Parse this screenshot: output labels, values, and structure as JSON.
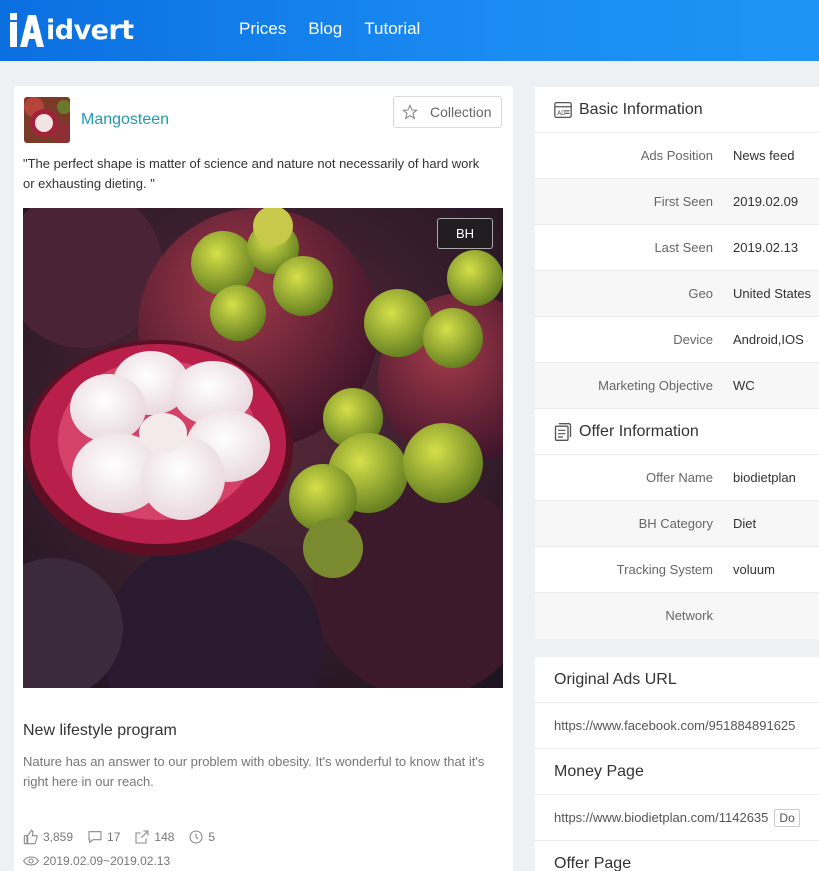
{
  "brand": {
    "name": "idvert"
  },
  "nav": {
    "items": [
      "Prices",
      "Blog",
      "Tutorial"
    ]
  },
  "ad": {
    "advertiser": "Mangosteen",
    "collection_label": "Collection",
    "quote": "\"The perfect shape is matter of science and nature not necessarily of hard work or exhausting dieting. \"",
    "badge": "BH",
    "title": "New lifestyle program",
    "body": "Nature has an answer to our problem with obesity. It's wonderful to know that it's right here in our reach.",
    "stats": {
      "likes": "3,859",
      "comments": "17",
      "shares": "148",
      "days": "5"
    },
    "date_range": "2019.02.09~2019.02.13"
  },
  "basic_info": {
    "title": "Basic Information",
    "rows": [
      {
        "label": "Ads Position",
        "value": "News feed"
      },
      {
        "label": "First Seen",
        "value": "2019.02.09"
      },
      {
        "label": "Last Seen",
        "value": "2019.02.13"
      },
      {
        "label": "Geo",
        "value": "United States"
      },
      {
        "label": "Device",
        "value": "Android,IOS"
      },
      {
        "label": "Marketing Objective",
        "value": "WC"
      }
    ]
  },
  "offer_info": {
    "title": "Offer Information",
    "rows": [
      {
        "label": "Offer Name",
        "value": "biodietplan"
      },
      {
        "label": "BH Category",
        "value": "Diet"
      },
      {
        "label": "Tracking System",
        "value": "voluum"
      },
      {
        "label": "Network",
        "value": ""
      }
    ]
  },
  "urls": {
    "original_title": "Original Ads URL",
    "original_url": "https://www.facebook.com/951884891625",
    "money_title": "Money Page",
    "money_url": "https://www.biodietplan.com/1142635",
    "money_button": "Do",
    "offer_title": "Offer Page"
  },
  "colors": {
    "header": "#1a8bf2",
    "link": "#1f9bb0"
  }
}
